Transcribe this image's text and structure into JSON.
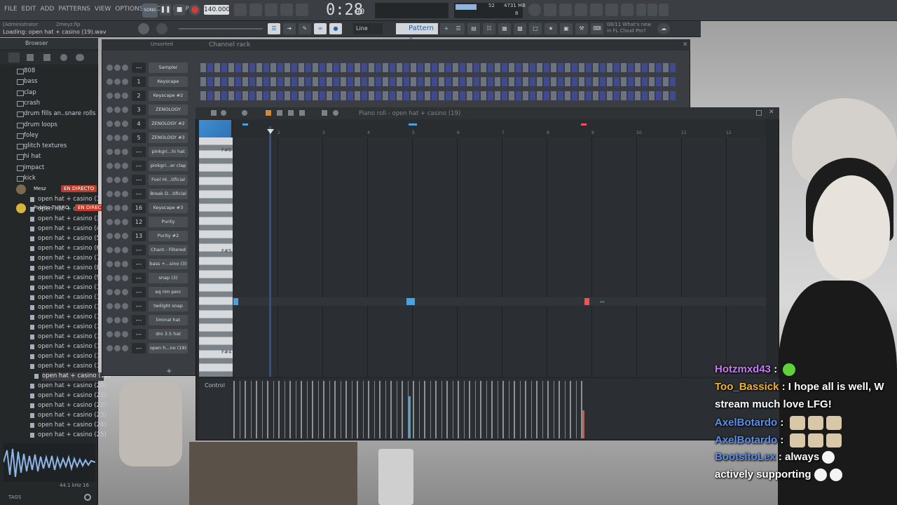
{
  "app": {
    "menu": [
      "FILE",
      "EDIT",
      "ADD",
      "PATTERNS",
      "VIEW",
      "OPTIONS",
      "TOOLS",
      "HELP"
    ],
    "song_mode": "SONG",
    "tempo": "140.000",
    "time": "0:28",
    "time_sub": "90",
    "cpu_percent": 52,
    "memory": "4731 MB",
    "voices": "8",
    "project_file": "2meyz.flp",
    "user": "[Administrator",
    "loading_text": "Loading: open hat + casino (19).wav",
    "hint": "Line",
    "pattern": "Pattern 4",
    "news": [
      "08/11  What's new",
      "in FL Cloud Pro?"
    ]
  },
  "browser": {
    "title": "Browser",
    "folders": [
      "808",
      "bass",
      "clap",
      "crash",
      "drum fills an..snare rolls",
      "drum loops",
      "foley",
      "glitch textures",
      "hi hat",
      "impact",
      "kick"
    ],
    "files": [
      "open hat + casino (1)",
      "open hat + casino (2)",
      "open hat + casino (3)",
      "open hat + casino (4)",
      "open hat + casino (5)",
      "open hat + casino (6)",
      "open hat + casino (7)",
      "open hat + casino (8)",
      "open hat + casino (9)",
      "open hat + casino (10)",
      "open hat + casino (11)",
      "open hat + casino (12)",
      "open hat + casino (13)",
      "open hat + casino (14)",
      "open hat + casino (15)",
      "open hat + casino (16)",
      "open hat + casino (17)",
      "open hat + casino (18)",
      "open hat + casino (19)",
      "open hat + casino (20)",
      "open hat + casino (21)",
      "open hat + casino (22)",
      "open hat + casino (23)",
      "open hat + casino (24)",
      "open hat + casino (25)"
    ],
    "sample_info": "44.1 kHz 16",
    "tags_label": "TAGS"
  },
  "live_overlay": [
    {
      "name": "Mesz",
      "badge": "EN DIRECTO"
    },
    {
      "name": "Pablito TURRO",
      "badge": "EN DIRECTO"
    }
  ],
  "channel_rack": {
    "title": "Channel rack",
    "filter": "Unsorted",
    "channels": [
      {
        "num": "---",
        "name": "Sampler"
      },
      {
        "num": "1",
        "name": "Keyscape"
      },
      {
        "num": "2",
        "name": "Keyscape #2"
      },
      {
        "num": "3",
        "name": "ZENOLOGY"
      },
      {
        "num": "4",
        "name": "ZENOLOGY #2"
      },
      {
        "num": "5",
        "name": "ZENOLOGY #3"
      },
      {
        "num": "---",
        "name": "pinkgri...hi hat"
      },
      {
        "num": "---",
        "name": "pinkgri...er clap"
      },
      {
        "num": "---",
        "name": "Fool Hi...tificial"
      },
      {
        "num": "---",
        "name": "Break D...tificial"
      },
      {
        "num": "16",
        "name": "Keyscape #3"
      },
      {
        "num": "12",
        "name": "Purity"
      },
      {
        "num": "13",
        "name": "Purity #2"
      },
      {
        "num": "---",
        "name": "Chant - Filtered"
      },
      {
        "num": "---",
        "name": "bass +...sino (3)"
      },
      {
        "num": "---",
        "name": "snap (3)"
      },
      {
        "num": "---",
        "name": "eq rim perc"
      },
      {
        "num": "---",
        "name": "twilight snap"
      },
      {
        "num": "---",
        "name": "liminal hat"
      },
      {
        "num": "---",
        "name": "dro 3.5 hat"
      },
      {
        "num": "---",
        "name": "open h...no (19)"
      }
    ],
    "add_label": "+"
  },
  "piano_roll": {
    "title": "Piano roll - open hat + casino (19)",
    "bars": [
      "2",
      "3",
      "4",
      "5",
      "6",
      "7",
      "8",
      "9",
      "10",
      "11",
      "12"
    ],
    "key_labels": [
      "F#6",
      "F#5",
      "F#4"
    ],
    "control_label": "Control",
    "colors": {
      "note_blue": "#4aa3e0",
      "note_red": "#e05a5a",
      "accent": "#3d8fd1"
    }
  },
  "chat": [
    {
      "user": "Hotzmxd43",
      "color": "#c57cf5",
      "text": "",
      "emotes": 1
    },
    {
      "user": "Too_Bassick",
      "color": "#f0b13a",
      "text": "I hope all is well, W",
      "emotes": 0
    },
    {
      "user": "",
      "color": "#ffffff",
      "text": "stream much love LFG!",
      "emotes": 0
    },
    {
      "user": "AxelBotardo",
      "color": "#5c8ee6",
      "text": "",
      "emotes": 3
    },
    {
      "user": "AxelBotardo",
      "color": "#5c8ee6",
      "text": "",
      "emotes": 3
    },
    {
      "user": "BootsitoLex",
      "color": "#5c8ee6",
      "text": "always",
      "emotes": 1
    },
    {
      "user": "",
      "color": "#ffffff",
      "text": "actively supporting",
      "emotes": 2
    }
  ]
}
